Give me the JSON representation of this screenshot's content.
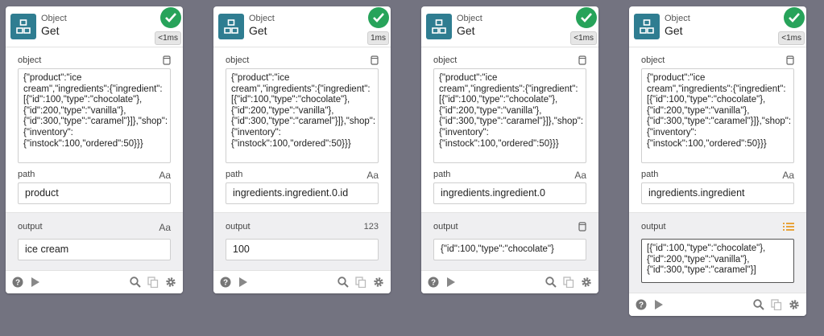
{
  "cards": [
    {
      "type_label": "Object",
      "name": "Get",
      "timing": "<1ms",
      "object_label": "object",
      "object_value": "{\"product\":\"ice cream\",\"ingredients\":{\"ingredient\":[{\"id\":100,\"type\":\"chocolate\"},{\"id\":200,\"type\":\"vanilla\"},{\"id\":300,\"type\":\"caramel\"}]},\"shop\":{\"inventory\":{\"instock\":100,\"ordered\":50}}}",
      "path_label": "path",
      "path_type": "Aa",
      "path_value": "product",
      "output_label": "output",
      "output_type": "Aa",
      "output_value": "ice cream"
    },
    {
      "type_label": "Object",
      "name": "Get",
      "timing": "1ms",
      "object_label": "object",
      "object_value": "{\"product\":\"ice cream\",\"ingredients\":{\"ingredient\":[{\"id\":100,\"type\":\"chocolate\"},{\"id\":200,\"type\":\"vanilla\"},{\"id\":300,\"type\":\"caramel\"}]},\"shop\":{\"inventory\":{\"instock\":100,\"ordered\":50}}}",
      "path_label": "path",
      "path_type": "Aa",
      "path_value": "ingredients.ingredient.0.id",
      "output_label": "output",
      "output_type": "123",
      "output_value": "100"
    },
    {
      "type_label": "Object",
      "name": "Get",
      "timing": "<1ms",
      "object_label": "object",
      "object_value": "{\"product\":\"ice cream\",\"ingredients\":{\"ingredient\":[{\"id\":100,\"type\":\"chocolate\"},{\"id\":200,\"type\":\"vanilla\"},{\"id\":300,\"type\":\"caramel\"}]},\"shop\":{\"inventory\":{\"instock\":100,\"ordered\":50}}}",
      "path_label": "path",
      "path_type": "Aa",
      "path_value": "ingredients.ingredient.0",
      "output_label": "output",
      "output_type": "object-icon",
      "output_value": "{\"id\":100,\"type\":\"chocolate\"}"
    },
    {
      "type_label": "Object",
      "name": "Get",
      "timing": "<1ms",
      "object_label": "object",
      "object_value": "{\"product\":\"ice cream\",\"ingredients\":{\"ingredient\":[{\"id\":100,\"type\":\"chocolate\"},{\"id\":200,\"type\":\"vanilla\"},{\"id\":300,\"type\":\"caramel\"}]},\"shop\":{\"inventory\":{\"instock\":100,\"ordered\":50}}}",
      "path_label": "path",
      "path_type": "Aa",
      "path_value": "ingredients.ingredient",
      "output_label": "output",
      "output_type": "list-icon",
      "output_value": "[{\"id\":100,\"type\":\"chocolate\"},{\"id\":200,\"type\":\"vanilla\"},{\"id\":300,\"type\":\"caramel\"}]"
    }
  ],
  "footer_icons": [
    "help-icon",
    "play-icon",
    "search-icon",
    "copy-icon",
    "gear-icon"
  ],
  "colors": {
    "accent": "#2f7d91",
    "success": "#27a35a",
    "list": "#e8a33a",
    "canvas": "#737380"
  }
}
